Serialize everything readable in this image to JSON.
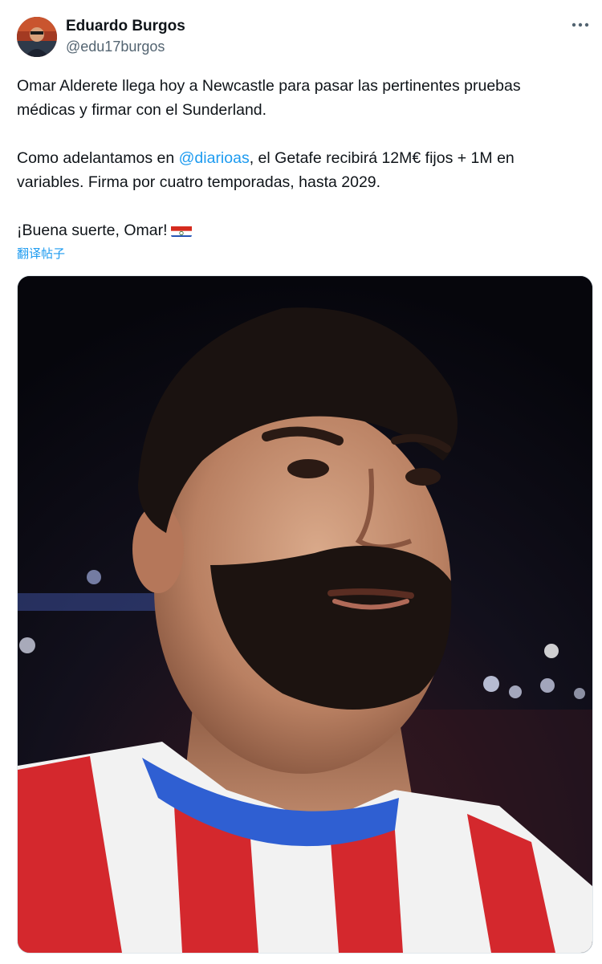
{
  "author": {
    "name": "Eduardo Burgos",
    "handle": "@edu17burgos",
    "avatar_icon": "avatar-photo"
  },
  "more_icon": "more-dots-icon",
  "tweet": {
    "p1": "Omar Alderete llega hoy a Newcastle para pasar las pertinentes pruebas médicas y firmar con el Sunderland.",
    "p2_before": "Como adelantamos en ",
    "p2_mention": "@diarioas",
    "p2_after": ", el Getafe recibirá 12M€ fijos + 1M en variables. Firma por cuatro temporadas, hasta 2029.",
    "p3": "¡Buena suerte, Omar!",
    "flag_icon": "paraguay-flag-icon"
  },
  "translate_link": "翻译帖子",
  "media": {
    "kind": "photo",
    "subject": "footballer-portrait"
  },
  "colors": {
    "link": "#1d9bf0",
    "text": "#0f1419",
    "secondary": "#536471"
  }
}
